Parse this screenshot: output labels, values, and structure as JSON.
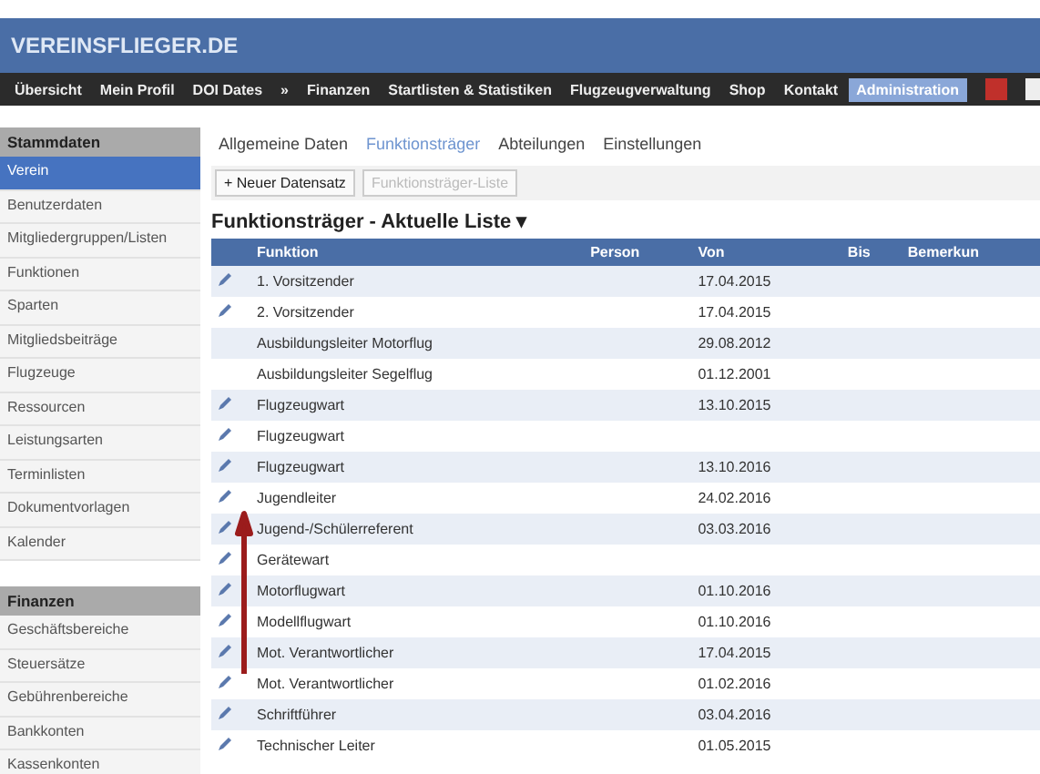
{
  "logo": "VEREINSFLIEGER.DE",
  "nav": [
    {
      "label": "Übersicht",
      "selected": false
    },
    {
      "label": "Mein Profil",
      "selected": false
    },
    {
      "label": "DOI Dates",
      "selected": false
    },
    {
      "label": "»",
      "selected": false
    },
    {
      "label": "Finanzen",
      "selected": false
    },
    {
      "label": "Startlisten & Statistiken",
      "selected": false
    },
    {
      "label": "Flugzeugverwaltung",
      "selected": false
    },
    {
      "label": "Shop",
      "selected": false
    },
    {
      "label": "Kontakt",
      "selected": false
    },
    {
      "label": "Administration",
      "selected": true
    }
  ],
  "sidebar": [
    {
      "kind": "header",
      "label": "Stammdaten"
    },
    {
      "kind": "item",
      "label": "Verein",
      "selected": true
    },
    {
      "kind": "item",
      "label": "Benutzerdaten",
      "selected": false
    },
    {
      "kind": "item",
      "label": "Mitgliedergruppen/Listen",
      "selected": false
    },
    {
      "kind": "item",
      "label": "Funktionen",
      "selected": false
    },
    {
      "kind": "item",
      "label": "Sparten",
      "selected": false
    },
    {
      "kind": "item",
      "label": "Mitgliedsbeiträge",
      "selected": false
    },
    {
      "kind": "item",
      "label": "Flugzeuge",
      "selected": false
    },
    {
      "kind": "item",
      "label": "Ressourcen",
      "selected": false
    },
    {
      "kind": "item",
      "label": "Leistungsarten",
      "selected": false
    },
    {
      "kind": "item",
      "label": "Terminlisten",
      "selected": false
    },
    {
      "kind": "item",
      "label": "Dokumentvorlagen",
      "selected": false
    },
    {
      "kind": "item",
      "label": "Kalender",
      "selected": false
    },
    {
      "kind": "header",
      "label": "Finanzen"
    },
    {
      "kind": "item",
      "label": "Geschäftsbereiche",
      "selected": false
    },
    {
      "kind": "item",
      "label": "Steuersätze",
      "selected": false
    },
    {
      "kind": "item",
      "label": "Gebührenbereiche",
      "selected": false
    },
    {
      "kind": "item",
      "label": "Bankkonten",
      "selected": false
    },
    {
      "kind": "item",
      "label": "Kassenkonten",
      "selected": false
    }
  ],
  "tabs": [
    {
      "label": "Allgemeine Daten",
      "selected": false
    },
    {
      "label": "Funktionsträger",
      "selected": true
    },
    {
      "label": "Abteilungen",
      "selected": false
    },
    {
      "label": "Einstellungen",
      "selected": false
    }
  ],
  "toolbar": [
    {
      "label": "+ Neuer Datensatz",
      "disabled": false
    },
    {
      "label": "Funktionsträger-Liste",
      "disabled": true
    }
  ],
  "list_title": "Funktionsträger - Aktuelle Liste ▾",
  "table": {
    "columns": [
      "Funktion",
      "Person",
      "Von",
      "Bis",
      "Bemerkun"
    ],
    "rows": [
      {
        "editable": true,
        "function": "1. Vorsitzender",
        "from": "17.04.2015"
      },
      {
        "editable": true,
        "function": "2. Vorsitzender",
        "from": "17.04.2015"
      },
      {
        "editable": false,
        "function": "Ausbildungsleiter Motorflug",
        "from": "29.08.2012"
      },
      {
        "editable": false,
        "function": "Ausbildungsleiter Segelflug",
        "from": "01.12.2001"
      },
      {
        "editable": true,
        "function": "Flugzeugwart",
        "from": "13.10.2015"
      },
      {
        "editable": true,
        "function": "Flugzeugwart"
      },
      {
        "editable": true,
        "function": "Flugzeugwart",
        "from": "13.10.2016"
      },
      {
        "editable": true,
        "function": "Jugendleiter",
        "from": "24.02.2016"
      },
      {
        "editable": true,
        "function": "Jugend-/Schülerreferent",
        "from": "03.03.2016"
      },
      {
        "editable": true,
        "function": "Gerätewart"
      },
      {
        "editable": true,
        "function": "Motorflugwart",
        "from": "01.10.2016"
      },
      {
        "editable": true,
        "function": "Modellflugwart",
        "from": "01.10.2016"
      },
      {
        "editable": true,
        "function": "Mot. Verantwortlicher",
        "from": "17.04.2015"
      },
      {
        "editable": true,
        "function": "Mot. Verantwortlicher",
        "from": "01.02.2016"
      },
      {
        "editable": true,
        "function": "Schriftführer",
        "from": "03.04.2016"
      },
      {
        "editable": true,
        "function": "Technischer Leiter",
        "from": "01.05.2015"
      }
    ]
  }
}
